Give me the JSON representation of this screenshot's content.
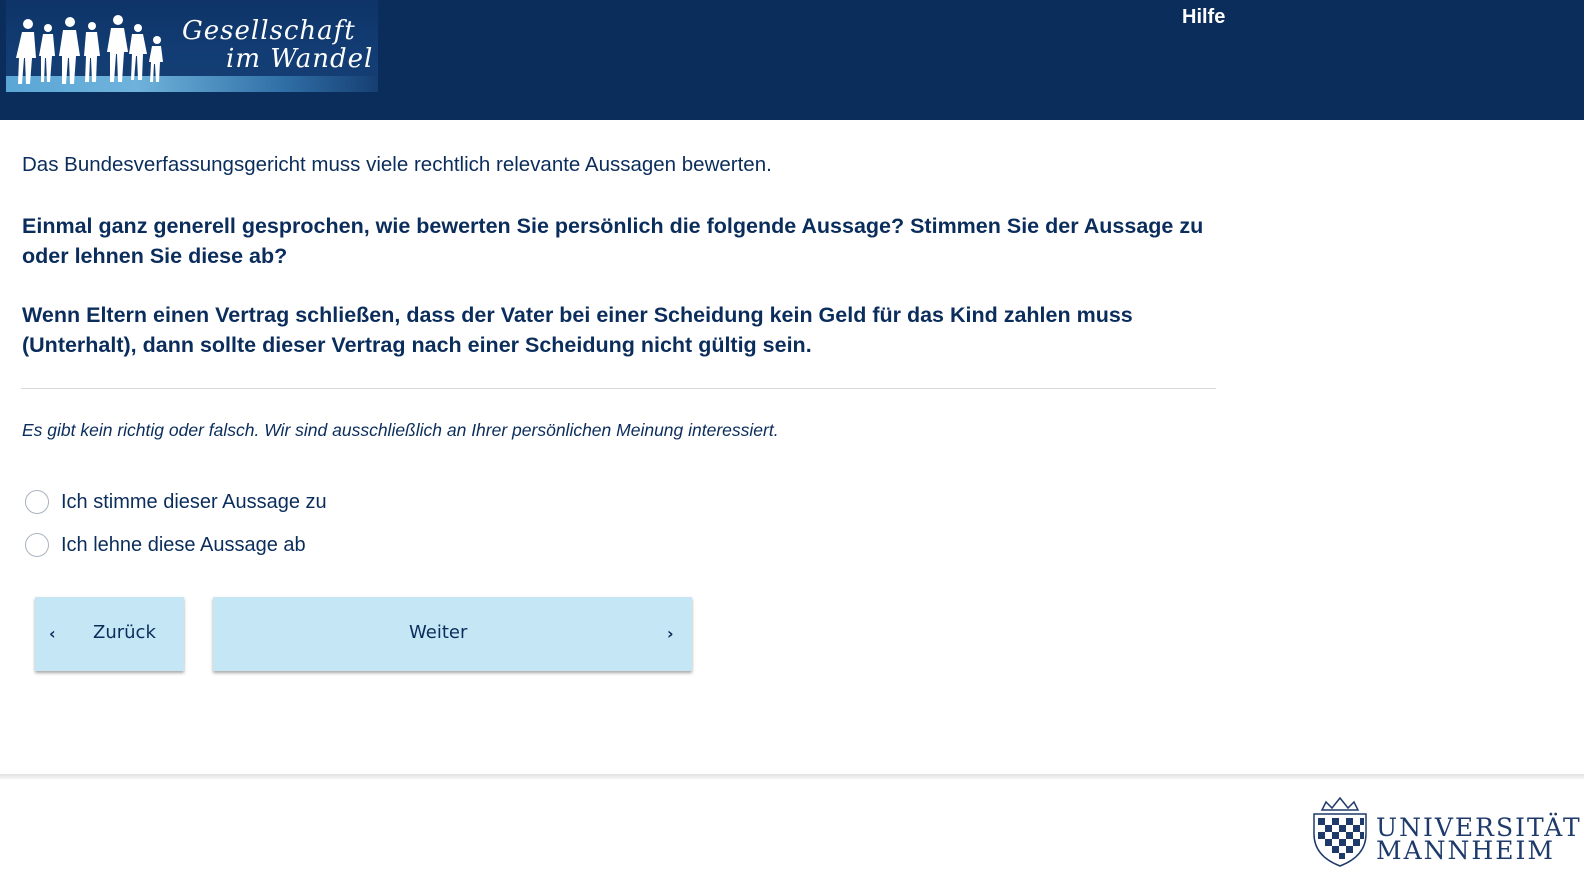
{
  "header": {
    "logo_line1": "Gesellschaft",
    "logo_line2": "im Wandel",
    "help_label": "Hilfe",
    "background_color": "#0b2d5c"
  },
  "question": {
    "intro": "Das Bundesverfassungsgericht muss viele rechtlich relevante Aussagen bewerten.",
    "prompt": "Einmal ganz generell gesprochen, wie bewerten Sie persönlich die folgende Aussage? Stimmen Sie der Aussage zu oder lehnen Sie diese ab?",
    "statement": "Wenn Eltern einen Vertrag schließen, dass der Vater bei einer Scheidung kein Geld für das Kind zahlen muss (Unterhalt), dann sollte dieser Vertrag nach einer Scheidung nicht gültig sein.",
    "note": "Es gibt kein richtig oder falsch. Wir sind ausschließlich an Ihrer persönlichen Meinung interessiert."
  },
  "options": [
    {
      "label": "Ich stimme dieser Aussage zu",
      "selected": false
    },
    {
      "label": "Ich lehne diese Aussage ab",
      "selected": false
    }
  ],
  "navigation": {
    "back_label": "Zurück",
    "next_label": "Weiter",
    "back_icon": "chevron-left-icon",
    "next_icon": "chevron-right-icon",
    "button_color": "#c5e6f4"
  },
  "footer": {
    "university_line1": "UNIVERSITÄT",
    "university_line2": "MANNHEIM"
  }
}
